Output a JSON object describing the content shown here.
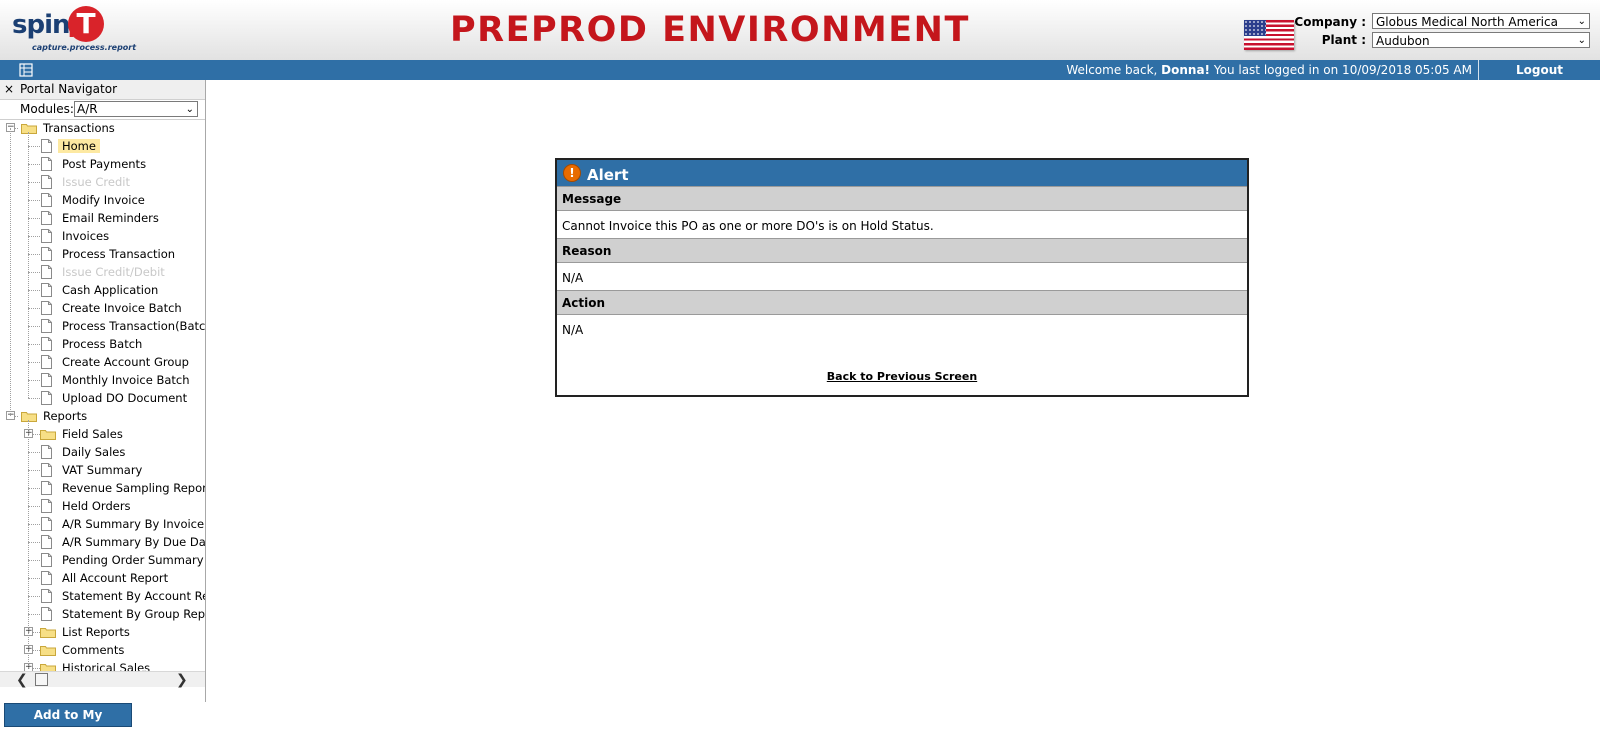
{
  "header": {
    "logo_word": "spine",
    "logo_t": "T",
    "logo_i": "i",
    "logo_tagline": "capture.process.report",
    "environment_title": "PREPROD ENVIRONMENT",
    "company_label": "Company :",
    "company_value": "Globus Medical North America",
    "plant_label": "Plant :",
    "plant_value": "Audubon",
    "flag_icon": "us-flag-icon"
  },
  "topbar": {
    "welcome_prefix": "Welcome back, ",
    "user_name": "Donna!",
    "welcome_suffix": " You last logged in on 10/09/2018 05:05 AM",
    "logout_label": "Logout"
  },
  "sidebar": {
    "close_glyph": "×",
    "title": "Portal Navigator",
    "modules_label": "Modules:",
    "modules_value": "A/R",
    "transactions_label": "Transactions",
    "transactions_items": [
      {
        "label": "Home",
        "state": "selected"
      },
      {
        "label": "Post Payments",
        "state": "normal"
      },
      {
        "label": "Issue Credit",
        "state": "disabled"
      },
      {
        "label": "Modify Invoice",
        "state": "normal"
      },
      {
        "label": "Email Reminders",
        "state": "normal"
      },
      {
        "label": "Invoices",
        "state": "normal"
      },
      {
        "label": "Process Transaction",
        "state": "normal"
      },
      {
        "label": "Issue Credit/Debit",
        "state": "disabled"
      },
      {
        "label": "Cash Application",
        "state": "normal"
      },
      {
        "label": "Create Invoice Batch",
        "state": "normal"
      },
      {
        "label": "Process Transaction(Batch)",
        "state": "normal"
      },
      {
        "label": "Process Batch",
        "state": "normal"
      },
      {
        "label": "Create Account Group",
        "state": "normal"
      },
      {
        "label": "Monthly Invoice Batch",
        "state": "normal"
      },
      {
        "label": "Upload DO Document",
        "state": "normal"
      }
    ],
    "reports_label": "Reports",
    "reports_items": [
      {
        "label": "Field Sales",
        "kind": "folder"
      },
      {
        "label": "Daily Sales",
        "kind": "doc"
      },
      {
        "label": "VAT Summary",
        "kind": "doc"
      },
      {
        "label": "Revenue Sampling Report",
        "kind": "doc"
      },
      {
        "label": "Held Orders",
        "kind": "doc"
      },
      {
        "label": "A/R Summary By Invoice Date",
        "kind": "doc"
      },
      {
        "label": "A/R Summary By Due Date",
        "kind": "doc"
      },
      {
        "label": "Pending Order Summary",
        "kind": "doc"
      },
      {
        "label": "All Account Report",
        "kind": "doc"
      },
      {
        "label": "Statement By Account Report",
        "kind": "doc"
      },
      {
        "label": "Statement By Group Report",
        "kind": "doc"
      },
      {
        "label": "List Reports",
        "kind": "folder"
      },
      {
        "label": "Comments",
        "kind": "folder"
      },
      {
        "label": "Historical Sales",
        "kind": "folder"
      }
    ],
    "add_favorites_label": "Add to My Favorites"
  },
  "alert": {
    "title": "Alert",
    "icon_glyph": "!",
    "message_header": "Message",
    "message_text": "Cannot Invoice this PO as one or more DO's is on Hold Status.",
    "reason_header": "Reason",
    "reason_text": "N/A",
    "action_header": "Action",
    "action_text": "N/A",
    "back_link": "Back to Previous Screen"
  },
  "colors": {
    "accent_blue": "#2f6fa6",
    "env_red": "#c4161c",
    "header_gray": "#d0d0d0",
    "selected_bg": "#fde9a2",
    "disabled_text": "#c8c8c8"
  }
}
